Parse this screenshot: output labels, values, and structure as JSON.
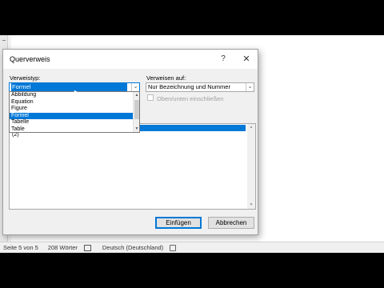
{
  "dialog": {
    "title": "Querverweis",
    "help_label": "?",
    "close_label": "✕",
    "verweistyp_label": "Verweistyp:",
    "verweistyp_value": "Formel",
    "verweisen_auf_label": "Verweisen auf:",
    "verweisen_auf_value": "Nur Bezeichnung und Nummer",
    "checkbox_label": "Oben/unten einschließen",
    "dropdown_items": [
      "Abbildung",
      "Equation",
      "Figure",
      "Formel",
      "Tabelle",
      "Table"
    ],
    "dropdown_selected_index": 3,
    "list_items": [
      "(2)"
    ],
    "insert_button": "Einfügen",
    "cancel_button": "Abbrechen"
  },
  "statusbar": {
    "page": "Seite 5 von 5",
    "words": "208 Wörter",
    "language": "Deutsch (Deutschland)"
  },
  "icons": {
    "dropdown_arrow": "chevron-down-icon",
    "close": "close-icon",
    "help": "help-icon"
  },
  "colors": {
    "accent": "#0078d7"
  }
}
